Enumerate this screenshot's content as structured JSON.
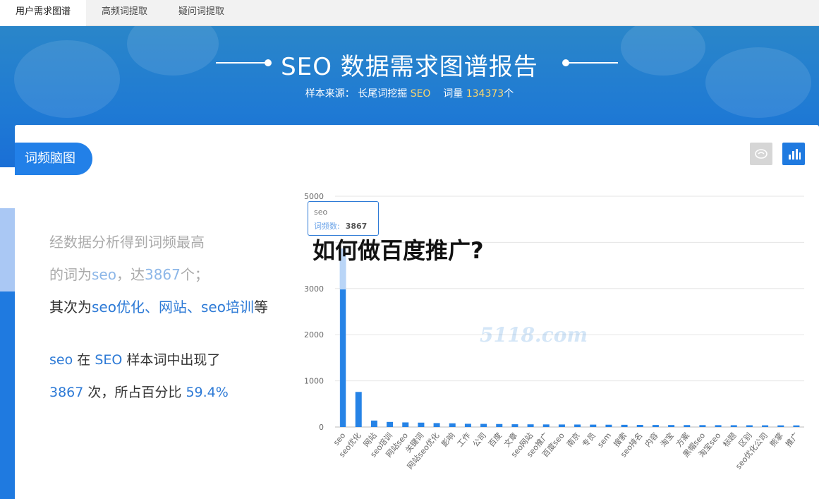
{
  "tabs": [
    {
      "label": "用户需求图谱"
    },
    {
      "label": "高频词提取"
    },
    {
      "label": "疑问词提取"
    }
  ],
  "hero": {
    "title": "SEO 数据需求图谱报告",
    "source_label": "样本来源：",
    "source_name": "长尾词挖掘",
    "source_keyword": "SEO",
    "count_label": "词量",
    "count_value": "134373",
    "count_unit": "个"
  },
  "section": {
    "pill": "词频脑图",
    "toggle_icons": [
      "brain-icon",
      "bar-chart-icon"
    ]
  },
  "desc": {
    "line1": "经数据分析得到词频最高",
    "line2_pre": "的词为",
    "line2_word": "seo",
    "line2_mid": "，达",
    "line2_num": "3867",
    "line2_post": "个；",
    "line3_pre": "其次为",
    "line3_w1": "seo优化",
    "line3_sep1": "、",
    "line3_w2": "网站",
    "line3_sep2": "、",
    "line3_w3": "seo培训",
    "line3_post": "等",
    "line4_word": "seo",
    "line4_mid": "在",
    "line4_kw": "SEO",
    "line4_post": "样本词中出现了",
    "line5_num": "3867",
    "line5_mid": "次，所占百分比",
    "line5_pct": "59.4%"
  },
  "overlay_title": "如何做百度推广?",
  "tooltip": {
    "name": "seo",
    "label": "词频数:",
    "value": "3867"
  },
  "watermark": "5118.com",
  "colors": {
    "accent": "#1f7ae0",
    "hero": "#2283d6",
    "highlight": "#ffd86a"
  },
  "chart_data": {
    "type": "bar",
    "categories": [
      "seo",
      "seo优化",
      "网站",
      "seo培训",
      "网站seo",
      "关键词",
      "网站seo优化",
      "影响",
      "工作",
      "公司",
      "百度",
      "文章",
      "seo网站",
      "seo推广",
      "百度seo",
      "南京",
      "专员",
      "sem",
      "搜索",
      "seo排名",
      "内容",
      "淘宝",
      "方案",
      "黑帽seo",
      "淘宝seo",
      "标题",
      "区别",
      "seo优化公司",
      "熊掌",
      "推广"
    ],
    "values": [
      3867,
      760,
      140,
      110,
      100,
      95,
      85,
      80,
      70,
      68,
      65,
      60,
      58,
      56,
      55,
      54,
      52,
      50,
      48,
      46,
      44,
      43,
      42,
      41,
      40,
      39,
      38,
      37,
      36,
      35
    ],
    "yticks": [
      "0",
      "1000",
      "2000",
      "3000",
      "5000"
    ],
    "ylim": [
      0,
      5000
    ],
    "grid": true
  }
}
